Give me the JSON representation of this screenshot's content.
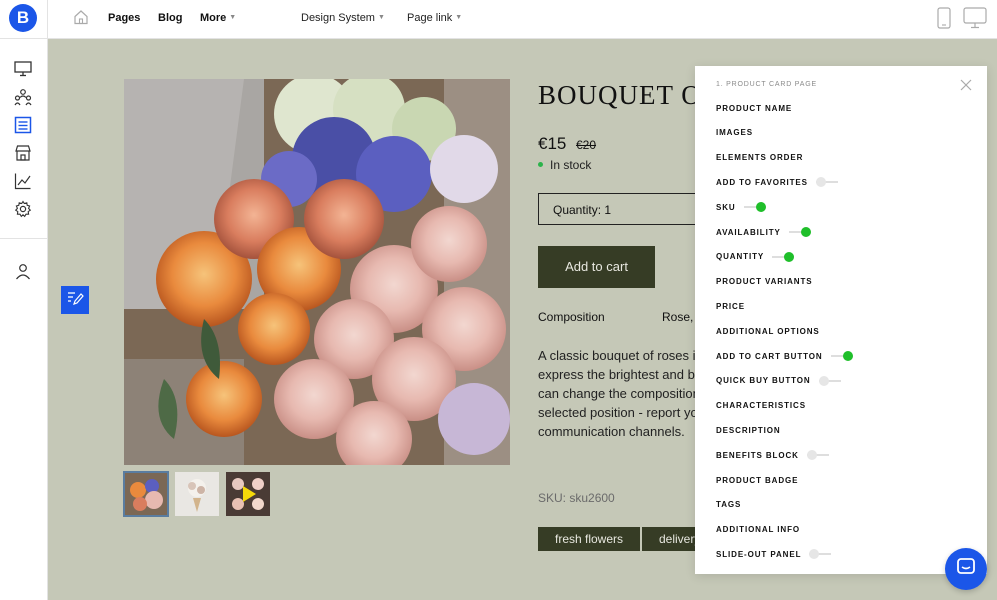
{
  "app": {
    "logo_letter": "B"
  },
  "topbar": {
    "nav": [
      {
        "label": "Pages"
      },
      {
        "label": "Blog"
      },
      {
        "label": "More"
      }
    ],
    "design_system": "Design System",
    "page_link": "Page link"
  },
  "product": {
    "title": "BOUQUET OF",
    "price": "€15",
    "old_price": "€20",
    "stock": "In stock",
    "quantity_label": "Quantity:",
    "quantity_value": "1",
    "add_to_cart": "Add to cart",
    "composition_label": "Composition",
    "composition_value": "Rose, I",
    "description_lines": [
      "A classic bouquet of roses is",
      "express the brightest and be",
      "can change the composition",
      "selected position - report you",
      "communication channels."
    ],
    "sku": "SKU: sku2600",
    "tags": [
      "fresh flowers",
      "delivery"
    ]
  },
  "panel": {
    "heading": "1. PRODUCT CARD PAGE",
    "rows": [
      {
        "label": "PRODUCT NAME",
        "toggle": null
      },
      {
        "label": "IMAGES",
        "toggle": null
      },
      {
        "label": "ELEMENTS ORDER",
        "toggle": null
      },
      {
        "label": "ADD TO FAVORITES",
        "toggle": "off"
      },
      {
        "label": "SKU",
        "toggle": "on"
      },
      {
        "label": "AVAILABILITY",
        "toggle": "on"
      },
      {
        "label": "QUANTITY",
        "toggle": "on"
      },
      {
        "label": "PRODUCT VARIANTS",
        "toggle": null
      },
      {
        "label": "PRICE",
        "toggle": null
      },
      {
        "label": "ADDITIONAL OPTIONS",
        "toggle": null
      },
      {
        "label": "ADD TO CART BUTTON",
        "toggle": "on"
      },
      {
        "label": "QUICK BUY BUTTON",
        "toggle": "off"
      },
      {
        "label": "CHARACTERISTICS",
        "toggle": null
      },
      {
        "label": "DESCRIPTION",
        "toggle": null
      },
      {
        "label": "BENEFITS BLOCK",
        "toggle": "off"
      },
      {
        "label": "PRODUCT BADGE",
        "toggle": null
      },
      {
        "label": "TAGS",
        "toggle": null
      },
      {
        "label": "ADDITIONAL INFO",
        "toggle": null
      },
      {
        "label": "SLIDE-OUT PANEL",
        "toggle": "off"
      }
    ]
  },
  "colors": {
    "accent": "#1b56e8",
    "background": "#c5c8b7",
    "button_dark": "#363c25",
    "toggle_on": "#1fbf2a"
  }
}
